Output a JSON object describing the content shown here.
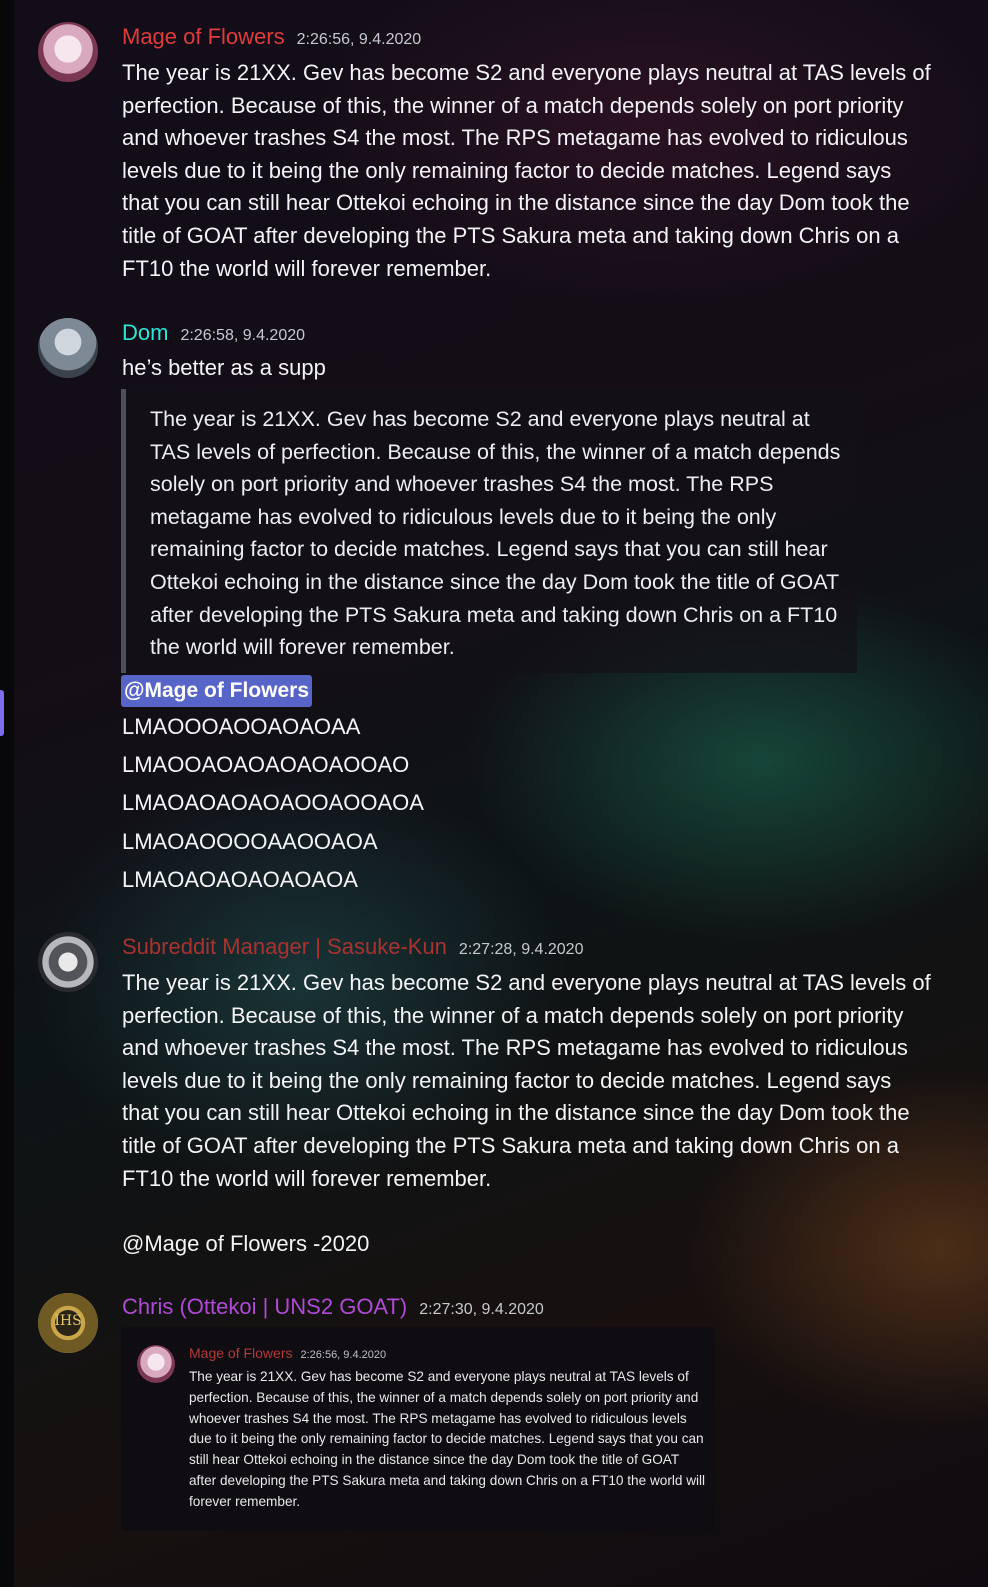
{
  "colors": {
    "mage_name": "#e03c3c",
    "dom_name": "#2ee6d6",
    "sasuke_name": "#a8332f",
    "chris_name": "#b04ad6",
    "mention_bg": "#5865c8"
  },
  "messages": [
    {
      "username": "Mage of Flowers",
      "timestamp": "2:26:56, 9.4.2020",
      "text": "The year is 21XX. Gev has become S2 and everyone plays neutral at TAS levels of perfection. Because of this, the winner of a match depends solely on port priority and whoever trashes S4 the most. The RPS metagame has evolved to ridiculous levels due to it being the only remaining factor to decide matches. Legend says that you can still hear Ottekoi echoing in the distance since the day Dom took the title of GOAT after developing the PTS Sakura meta and taking down Chris on a FT10 the world will forever remember."
    },
    {
      "username": "Dom",
      "timestamp": "2:26:58, 9.4.2020",
      "text": "he’s better as a supp",
      "quote": "The year is 21XX. Gev has become S2 and everyone plays neutral at TAS levels of perfection. Because of this, the winner of a match depends solely on port priority and whoever trashes S4 the most. The RPS metagame has evolved to ridiculous levels due to it being the only remaining factor to decide matches. Legend says that you can still hear Ottekoi echoing in the distance since the day Dom took the title of GOAT after developing the PTS Sakura meta and taking down Chris on a FT10 the world will forever remember.",
      "mention": "@Mage of Flowers",
      "lines": [
        "LMAOOOAOOAOAOAA",
        "LMAOOAOAOAOAOAOOAO",
        "LMAOAOAOAOAOOAOOAOA",
        "LMAOAOOOOAAOOAOA",
        "LMAOAOAOAOAOAOA"
      ]
    },
    {
      "username": "Subreddit Manager | Sasuke-Kun",
      "timestamp": "2:27:28, 9.4.2020",
      "text": "The year is 21XX. Gev has become S2 and everyone plays neutral at TAS levels of perfection. Because of this, the winner of a match depends solely on port priority and whoever trashes S4 the most. The RPS metagame has evolved to ridiculous levels due to it being the only remaining factor to decide matches. Legend says that you can still hear Ottekoi echoing in the distance since the day Dom took the title of GOAT after developing the PTS Sakura meta and taking down Chris on a FT10 the world will forever remember.\n\n@Mage of Flowers -2020"
    },
    {
      "username": "Chris (Ottekoi | UNS2 GOAT)",
      "timestamp": "2:27:30, 9.4.2020",
      "avatar_text": "IHS",
      "embed": {
        "username": "Mage of Flowers",
        "timestamp": "2:26:56, 9.4.2020",
        "text": "The year is 21XX. Gev has become S2 and everyone plays neutral at TAS levels of perfection. Because of this, the winner of a match depends solely on port priority and whoever trashes S4 the most. The RPS metagame has evolved to ridiculous levels due to it being the only remaining factor to decide matches. Legend says that you can still hear Ottekoi echoing in the distance since the day Dom took the title of GOAT after developing the PTS Sakura meta and taking down Chris on a FT10 the world will forever remember."
      }
    }
  ]
}
